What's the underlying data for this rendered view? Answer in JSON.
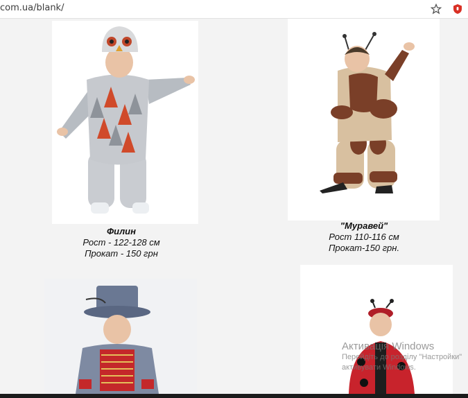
{
  "browser": {
    "url": "com.ua/blank/",
    "star_icon": "star-icon",
    "extension_icon": "shield-extension-icon"
  },
  "products": [
    {
      "name": "Филин",
      "height": "Рост - 122-128 см",
      "rental": "Прокат - 150 грн"
    },
    {
      "name": "\"Муравей\"",
      "height": "Рост 110-116 см",
      "rental": "Прокат-150 грн."
    }
  ],
  "watermark": {
    "title": "Активація Windows",
    "line1": "Перейдіть до розділу \"Настройки\"",
    "line2": "активувати Windows."
  },
  "colors": {
    "page_bg": "#f3f3f3",
    "extension_red": "#d93025"
  }
}
